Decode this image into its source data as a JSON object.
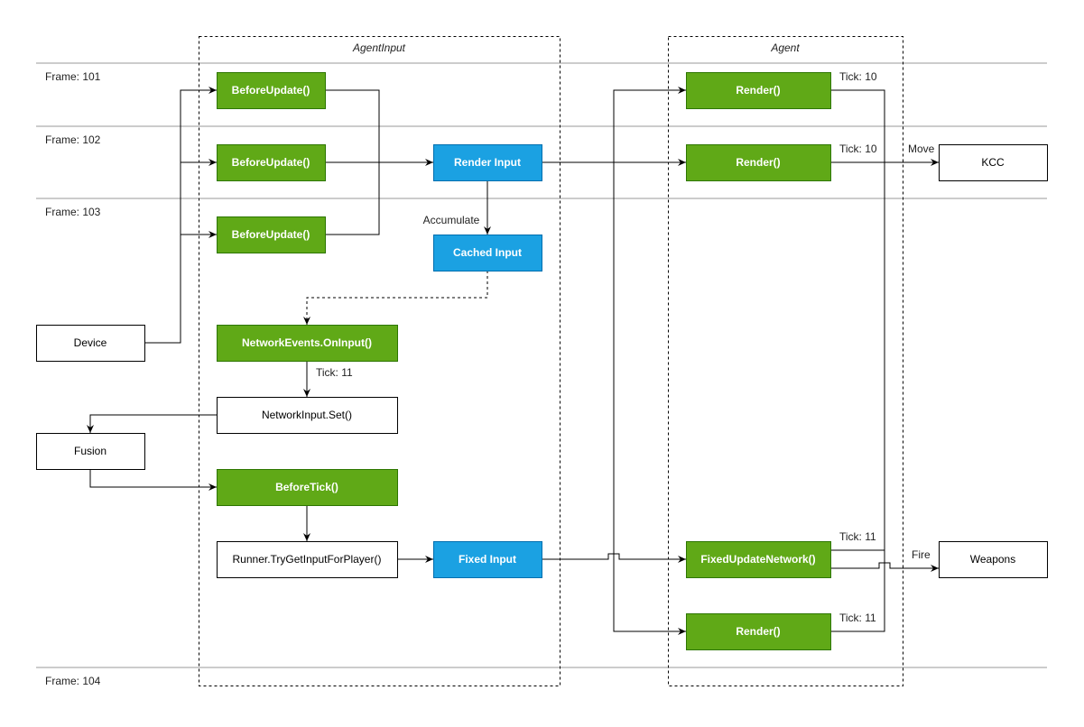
{
  "colors": {
    "green": "#60a917",
    "green_border": "#2d7600",
    "blue": "#1ba1e2",
    "blue_border": "#006eaf",
    "frame_line": "#999999"
  },
  "containers": {
    "agent_input": "AgentInput",
    "agent": "Agent"
  },
  "frames": [
    "Frame: 101",
    "Frame: 102",
    "Frame: 103",
    "Frame: 104"
  ],
  "nodes": {
    "before_update_1": "BeforeUpdate()",
    "before_update_2": "BeforeUpdate()",
    "before_update_3": "BeforeUpdate()",
    "render_input": "Render Input",
    "cached_input": "Cached Input",
    "on_input": "NetworkEvents.OnInput()",
    "input_set": "NetworkInput.Set()",
    "before_tick": "BeforeTick()",
    "try_get_input": "Runner.TryGetInputForPlayer()",
    "fixed_input": "Fixed Input",
    "device": "Device",
    "fusion": "Fusion",
    "render_1": "Render()",
    "render_2": "Render()",
    "fixed_update_network": "FixedUpdateNetwork()",
    "render_3": "Render()",
    "kcc": "KCC",
    "weapons": "Weapons"
  },
  "edge_labels": {
    "accumulate": "Accumulate",
    "tick_on_input": "Tick: 11",
    "tick_render_1": "Tick: 10",
    "tick_render_2": "Tick: 10",
    "tick_fun": "Tick: 11",
    "tick_render_3": "Tick: 11",
    "move": "Move",
    "fire": "Fire"
  }
}
